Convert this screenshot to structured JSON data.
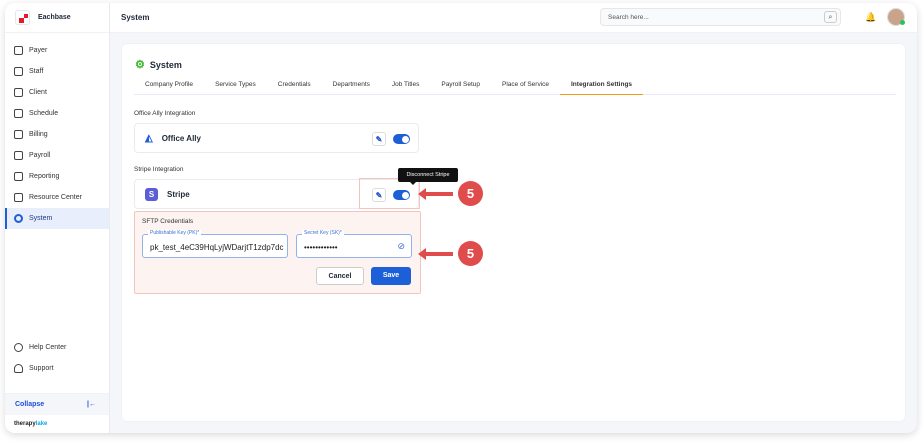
{
  "brand": {
    "name": "Eachbase",
    "footer_logo": "therapylake"
  },
  "sidebar": {
    "items": [
      {
        "label": "Payer"
      },
      {
        "label": "Staff"
      },
      {
        "label": "Client"
      },
      {
        "label": "Schedule"
      },
      {
        "label": "Billing"
      },
      {
        "label": "Payroll"
      },
      {
        "label": "Reporting"
      },
      {
        "label": "Resource Center"
      },
      {
        "label": "System",
        "active": true
      }
    ],
    "bottom": [
      {
        "label": "Help Center"
      },
      {
        "label": "Support"
      }
    ],
    "collapse": "Collapse"
  },
  "header": {
    "title": "System",
    "search_placeholder": "Search here..."
  },
  "page": {
    "title": "System",
    "tabs": [
      "Company Profile",
      "Service Types",
      "Credentials",
      "Departments",
      "Job Titles",
      "Payroll Setup",
      "Place of Service",
      "Integration Settings"
    ],
    "active_tab": "Integration Settings"
  },
  "office_ally": {
    "section": "Office Ally Integration",
    "name": "Office Ally",
    "enabled": true
  },
  "stripe": {
    "section": "Stripe Integration",
    "name": "Stripe",
    "enabled": true,
    "tooltip": "Disconnect Stripe",
    "sftp": {
      "title": "SFTP Credentials",
      "pk_label": "Publishable Key (PK)*",
      "pk_value": "pk_test_4eC39HqLyjWDarjtT1zdp7dc",
      "sk_label": "Secret Key (SK)*",
      "sk_value": "••••••••••••",
      "cancel": "Cancel",
      "save": "Save"
    }
  },
  "annotations": [
    "5",
    "5"
  ]
}
